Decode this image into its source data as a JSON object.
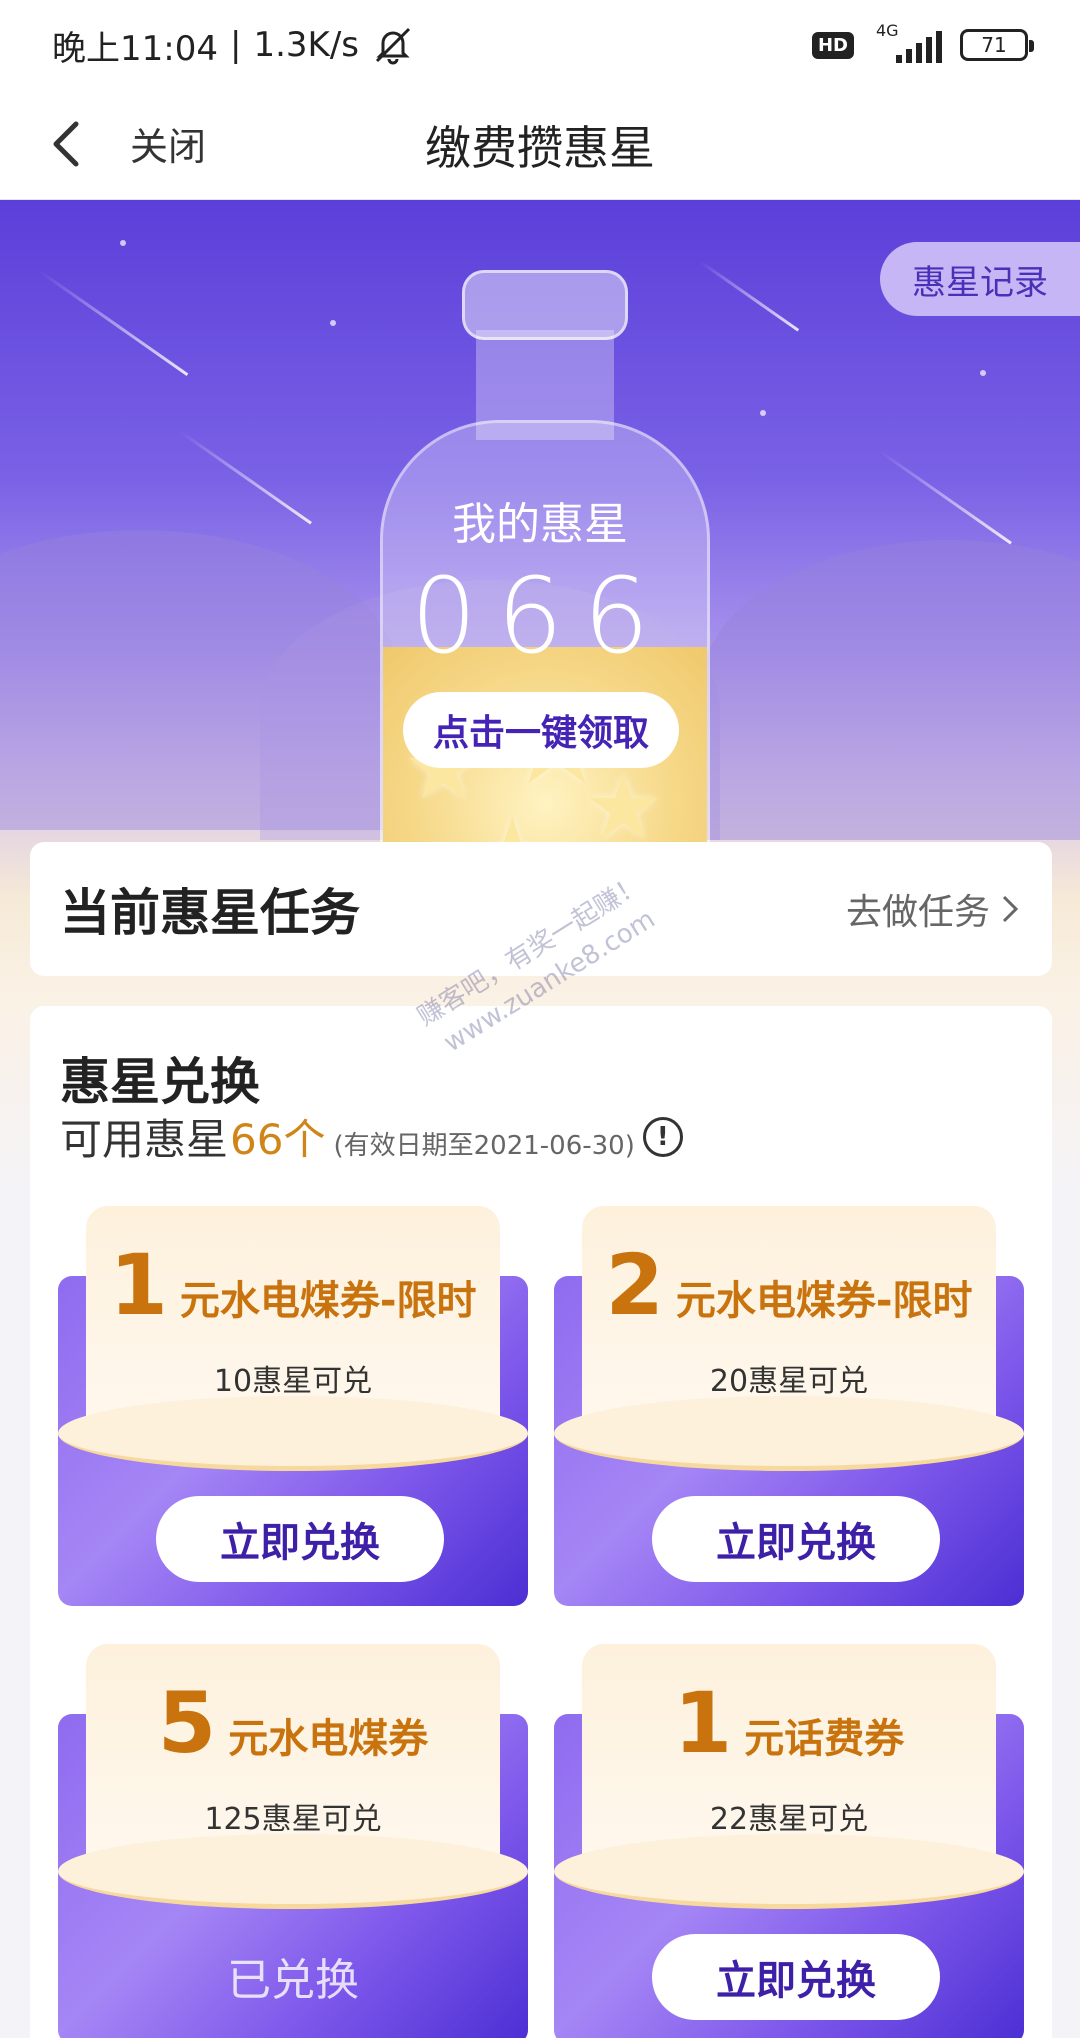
{
  "status_bar": {
    "time": "晚上11:04",
    "separator": "|",
    "speed": "1.3K/s",
    "hd": "HD",
    "network": "4G",
    "battery": "71"
  },
  "nav": {
    "close_label": "关闭",
    "title": "缴费攒惠星"
  },
  "hero": {
    "record_button": "惠星记录",
    "my_label": "我的惠星",
    "count": "066",
    "claim_button": "点击一键领取"
  },
  "task_card": {
    "title": "当前惠星任务",
    "link": "去做任务"
  },
  "exchange": {
    "title": "惠星兑换",
    "available_prefix": "可用惠星",
    "available_count": "66个",
    "validity": "(有效日期至2021-06-30)",
    "coupons": [
      {
        "amount": "1",
        "name": "元水电煤券-限时",
        "cost": "10惠星可兑",
        "action": "立即兑换"
      },
      {
        "amount": "2",
        "name": "元水电煤券-限时",
        "cost": "20惠星可兑",
        "action": "立即兑换"
      },
      {
        "amount": "5",
        "name": "元水电煤券",
        "cost": "125惠星可兑",
        "status": "已兑换"
      },
      {
        "amount": "1",
        "name": "元话费券",
        "cost": "22惠星可兑",
        "action": "立即兑换"
      }
    ]
  },
  "watermark": {
    "line1": "赚客吧，有奖一起赚！",
    "line2": "www.zuanke8.com"
  },
  "colors": {
    "brand_purple": "#4524b5",
    "accent_orange": "#c9730e",
    "amount_orange": "#d08519"
  }
}
